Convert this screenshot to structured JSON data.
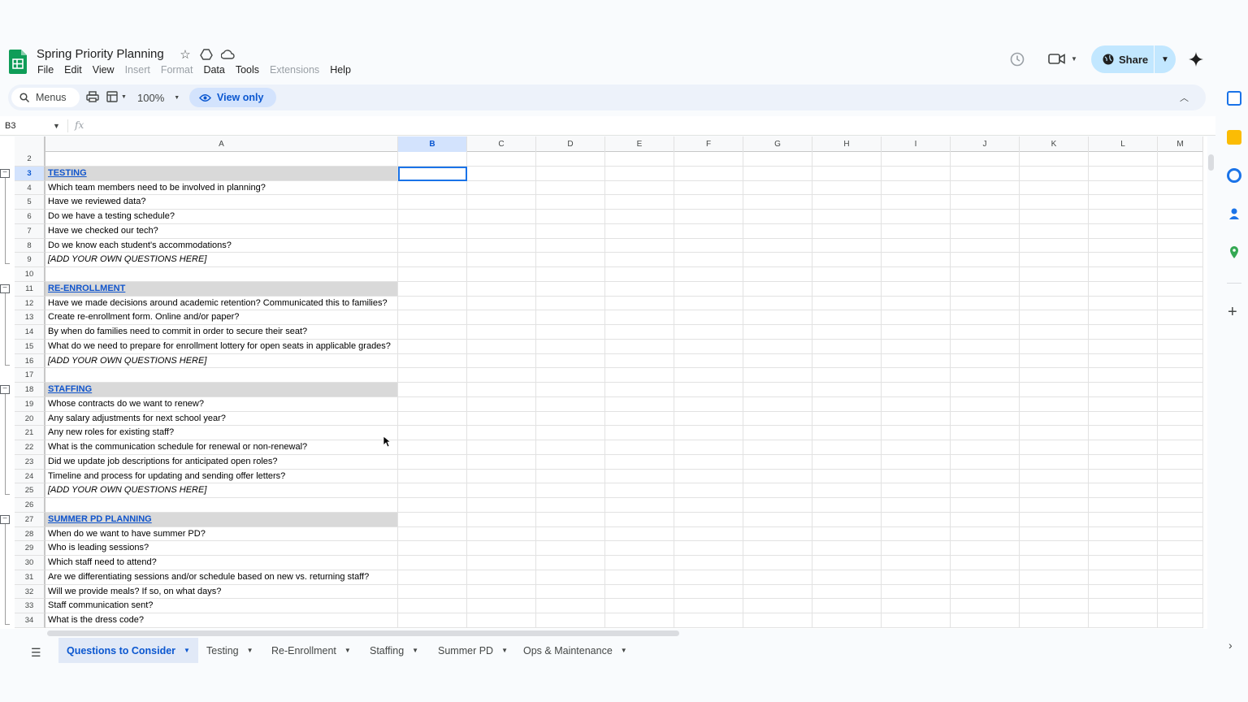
{
  "doc": {
    "title": "Spring Priority Planning",
    "menus": [
      {
        "label": "File",
        "enabled": true
      },
      {
        "label": "Edit",
        "enabled": true
      },
      {
        "label": "View",
        "enabled": true
      },
      {
        "label": "Insert",
        "enabled": false
      },
      {
        "label": "Format",
        "enabled": false
      },
      {
        "label": "Data",
        "enabled": true
      },
      {
        "label": "Tools",
        "enabled": true
      },
      {
        "label": "Extensions",
        "enabled": false
      },
      {
        "label": "Help",
        "enabled": true
      }
    ],
    "share_label": "Share"
  },
  "toolbar": {
    "search_label": "Menus",
    "zoom": "100%",
    "view_only_label": "View only"
  },
  "formula_bar": {
    "name_box": "B3",
    "fx_label": "fx"
  },
  "columns": [
    "A",
    "B",
    "C",
    "D",
    "E",
    "F",
    "G",
    "H",
    "I",
    "J",
    "K",
    "L",
    "M"
  ],
  "selected_cell": "B3",
  "rows": [
    {
      "n": "2",
      "a": "",
      "style": "plain"
    },
    {
      "n": "3",
      "a": "TESTING",
      "style": "section"
    },
    {
      "n": "4",
      "a": "Which team members need to be involved in planning?",
      "style": "plain"
    },
    {
      "n": "5",
      "a": "Have we reviewed data?",
      "style": "plain"
    },
    {
      "n": "6",
      "a": "Do we have a testing schedule?",
      "style": "plain"
    },
    {
      "n": "7",
      "a": "Have we checked our tech?",
      "style": "plain"
    },
    {
      "n": "8",
      "a": "Do we know each student's accommodations?",
      "style": "plain"
    },
    {
      "n": "9",
      "a": "[ADD YOUR OWN QUESTIONS HERE]",
      "style": "italic"
    },
    {
      "n": "10",
      "a": "",
      "style": "plain"
    },
    {
      "n": "11",
      "a": "RE-ENROLLMENT",
      "style": "section"
    },
    {
      "n": "12",
      "a": "Have we made decisions around academic retention? Communicated this to families?",
      "style": "plain"
    },
    {
      "n": "13",
      "a": "Create re-enrollment form. Online and/or paper?",
      "style": "plain"
    },
    {
      "n": "14",
      "a": "By when do families need to commit in order to secure their seat?",
      "style": "plain"
    },
    {
      "n": "15",
      "a": "What do we need to prepare for enrollment lottery for open seats in applicable grades?",
      "style": "plain"
    },
    {
      "n": "16",
      "a": "[ADD YOUR OWN QUESTIONS HERE]",
      "style": "italic"
    },
    {
      "n": "17",
      "a": "",
      "style": "plain"
    },
    {
      "n": "18",
      "a": "STAFFING",
      "style": "section"
    },
    {
      "n": "19",
      "a": "Whose contracts do we want to renew?",
      "style": "plain"
    },
    {
      "n": "20",
      "a": "Any salary adjustments for next school year?",
      "style": "plain"
    },
    {
      "n": "21",
      "a": "Any new roles for existing staff?",
      "style": "plain"
    },
    {
      "n": "22",
      "a": "What is the communication schedule for renewal or non-renewal?",
      "style": "plain"
    },
    {
      "n": "23",
      "a": "Did we update job descriptions for anticipated open roles?",
      "style": "plain"
    },
    {
      "n": "24",
      "a": "Timeline and process for updating and sending offer letters?",
      "style": "plain"
    },
    {
      "n": "25",
      "a": "[ADD YOUR OWN QUESTIONS HERE]",
      "style": "italic"
    },
    {
      "n": "26",
      "a": "",
      "style": "plain"
    },
    {
      "n": "27",
      "a": "SUMMER PD PLANNING",
      "style": "section"
    },
    {
      "n": "28",
      "a": "When do we want to have summer PD?",
      "style": "plain"
    },
    {
      "n": "29",
      "a": "Who is leading sessions?",
      "style": "plain"
    },
    {
      "n": "30",
      "a": "Which staff need to attend?",
      "style": "plain"
    },
    {
      "n": "31",
      "a": "Are we differentiating sessions and/or schedule based on new vs. returning staff?",
      "style": "plain"
    },
    {
      "n": "32",
      "a": "Will we provide meals? If so, on what days?",
      "style": "plain"
    },
    {
      "n": "33",
      "a": "Staff communication sent?",
      "style": "plain"
    },
    {
      "n": "34",
      "a": "What is the dress code?",
      "style": "plain"
    }
  ],
  "sheet_tabs": [
    {
      "label": "Questions to Consider",
      "active": true
    },
    {
      "label": "Testing",
      "active": false
    },
    {
      "label": "Re-Enrollment",
      "active": false
    },
    {
      "label": "Staffing",
      "active": false
    },
    {
      "label": "Summer PD",
      "active": false
    },
    {
      "label": "Ops & Maintenance",
      "active": false
    }
  ],
  "colors": {
    "accent": "#0b57d0",
    "section_fill": "#d9d9d9",
    "link": "#1155cc",
    "share_bg": "#c2e7ff",
    "sheets_green": "#0f9d58"
  }
}
